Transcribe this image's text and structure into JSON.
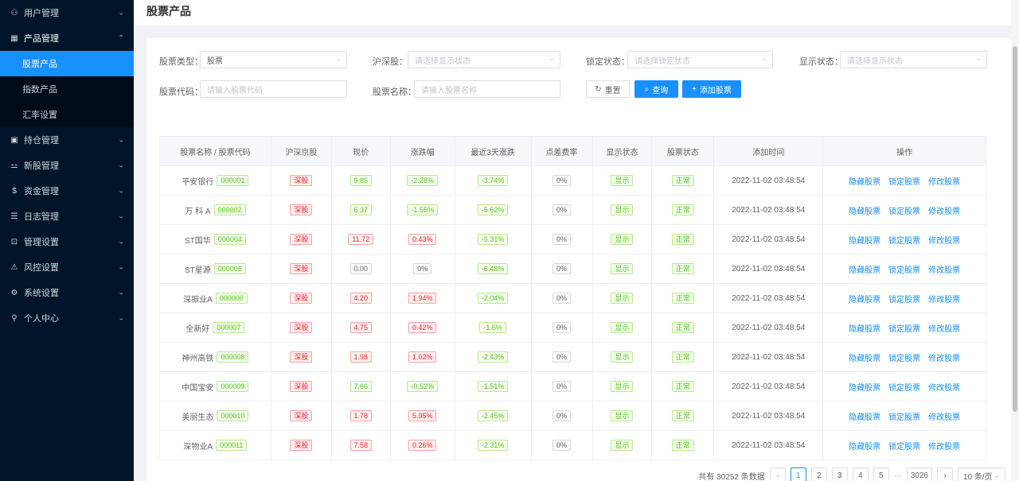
{
  "sidebar": {
    "items": [
      {
        "label": "用户管理",
        "icon": "users-icon",
        "glyph": "⚇",
        "chevron": "⌄"
      },
      {
        "label": "产品管理",
        "icon": "chart-icon",
        "glyph": "▦",
        "chevron": "⌃"
      },
      {
        "label": "持仓管理",
        "icon": "position-icon",
        "glyph": "▣",
        "chevron": "⌄"
      },
      {
        "label": "新股管理",
        "icon": "ipo-icon",
        "glyph": "⚍",
        "chevron": "⌄"
      },
      {
        "label": "资金管理",
        "icon": "money-icon",
        "glyph": "$",
        "chevron": "⌄"
      },
      {
        "label": "日志管理",
        "icon": "log-icon",
        "glyph": "☰",
        "chevron": "⌄"
      },
      {
        "label": "管理设置",
        "icon": "admin-icon",
        "glyph": "⊡",
        "chevron": "⌄"
      },
      {
        "label": "风控设置",
        "icon": "warning-icon",
        "glyph": "⚠",
        "chevron": "⌄"
      },
      {
        "label": "系统设置",
        "icon": "gear-icon",
        "glyph": "⚙",
        "chevron": "⌄"
      },
      {
        "label": "个人中心",
        "icon": "user-icon",
        "glyph": "⚲",
        "chevron": "⌄"
      }
    ],
    "submenu": [
      "股票产品",
      "指数产品",
      "汇率设置"
    ]
  },
  "page": {
    "title": "股票产品"
  },
  "filters": {
    "stock_type_label": "股票类型：",
    "stock_type_value": "股票",
    "market_label": "沪深股：",
    "market_placeholder": "请选择显示状态",
    "lock_label": "锁定状态：",
    "lock_placeholder": "请选择锁定状态",
    "display_label": "显示状态：",
    "display_placeholder": "请选择显示状态",
    "code_label": "股票代码：",
    "code_placeholder": "请输入股票代码",
    "name_label": "股票名称：",
    "name_placeholder": "请输入股票名称",
    "reset": "重置",
    "query": "查询",
    "add": "添加股票"
  },
  "table": {
    "headers": [
      "股票名称 / 股票代码",
      "沪深京股",
      "现价",
      "涨跌幅",
      "最近3天涨跌",
      "点差费率",
      "显示状态",
      "股票状态",
      "添加时间",
      "操作"
    ],
    "actions": [
      "隐藏股票",
      "锁定股票",
      "修改股票"
    ],
    "rows": [
      {
        "name": "平安银行",
        "code": "000001",
        "market": "深股",
        "price": "9.85",
        "price_dir": "up",
        "change": "-2.28%",
        "change_dir": "down",
        "three_day": "-3.74%",
        "spread": "0%",
        "display": "显示",
        "status": "正常",
        "time": "2022-11-02 03:48:54"
      },
      {
        "name": "万 科 A",
        "code": "000002",
        "market": "深股",
        "price": "6.37",
        "price_dir": "up",
        "change": "-1.55%",
        "change_dir": "down",
        "three_day": "-5.62%",
        "spread": "0%",
        "display": "显示",
        "status": "正常",
        "time": "2022-11-02 03:48:54"
      },
      {
        "name": "ST国华",
        "code": "000004",
        "market": "深股",
        "price": "11.72",
        "price_dir": "red",
        "change": "0.43%",
        "change_dir": "red",
        "three_day": "-5.31%",
        "spread": "0%",
        "display": "显示",
        "status": "正常",
        "time": "2022-11-02 03:48:54"
      },
      {
        "name": "ST星源",
        "code": "000005",
        "market": "深股",
        "price": "0.00",
        "price_dir": "flat",
        "change": "0%",
        "change_dir": "flat",
        "three_day": "-6.48%",
        "spread": "0%",
        "display": "显示",
        "status": "正常",
        "time": "2022-11-02 03:48:54"
      },
      {
        "name": "深振业A",
        "code": "000006",
        "market": "深股",
        "price": "4.20",
        "price_dir": "red",
        "change": "1.94%",
        "change_dir": "red",
        "three_day": "-2.04%",
        "spread": "0%",
        "display": "显示",
        "status": "正常",
        "time": "2022-11-02 03:48:54"
      },
      {
        "name": "全新好",
        "code": "000007",
        "market": "深股",
        "price": "4.75",
        "price_dir": "red",
        "change": "0.42%",
        "change_dir": "red",
        "three_day": "-1.6%",
        "spread": "0%",
        "display": "显示",
        "status": "正常",
        "time": "2022-11-02 03:48:54"
      },
      {
        "name": "神州高铁",
        "code": "000008",
        "market": "深股",
        "price": "1.98",
        "price_dir": "red",
        "change": "1.02%",
        "change_dir": "red",
        "three_day": "-2.43%",
        "spread": "0%",
        "display": "显示",
        "status": "正常",
        "time": "2022-11-02 03:48:54"
      },
      {
        "name": "中国宝安",
        "code": "000009",
        "market": "深股",
        "price": "7.66",
        "price_dir": "up",
        "change": "-0.52%",
        "change_dir": "down",
        "three_day": "-1.51%",
        "spread": "0%",
        "display": "显示",
        "status": "正常",
        "time": "2022-11-02 03:48:54"
      },
      {
        "name": "美丽生态",
        "code": "000010",
        "market": "深股",
        "price": "1.78",
        "price_dir": "red",
        "change": "5.95%",
        "change_dir": "red",
        "three_day": "-2.45%",
        "spread": "0%",
        "display": "显示",
        "status": "正常",
        "time": "2022-11-02 03:48:54"
      },
      {
        "name": "深物业A",
        "code": "000011",
        "market": "深股",
        "price": "7.58",
        "price_dir": "red",
        "change": "0.26%",
        "change_dir": "red",
        "three_day": "-2.31%",
        "spread": "0%",
        "display": "显示",
        "status": "正常",
        "time": "2022-11-02 03:48:54"
      }
    ]
  },
  "pagination": {
    "total_text": "共有 30252 条数据",
    "pages": [
      "1",
      "2",
      "3",
      "4",
      "5"
    ],
    "ellipsis": "···",
    "last_page": "3026",
    "page_size": "10 条/页",
    "current": "1"
  },
  "colors": {
    "accent": "#1890ff",
    "sidebar_bg": "#001529"
  }
}
